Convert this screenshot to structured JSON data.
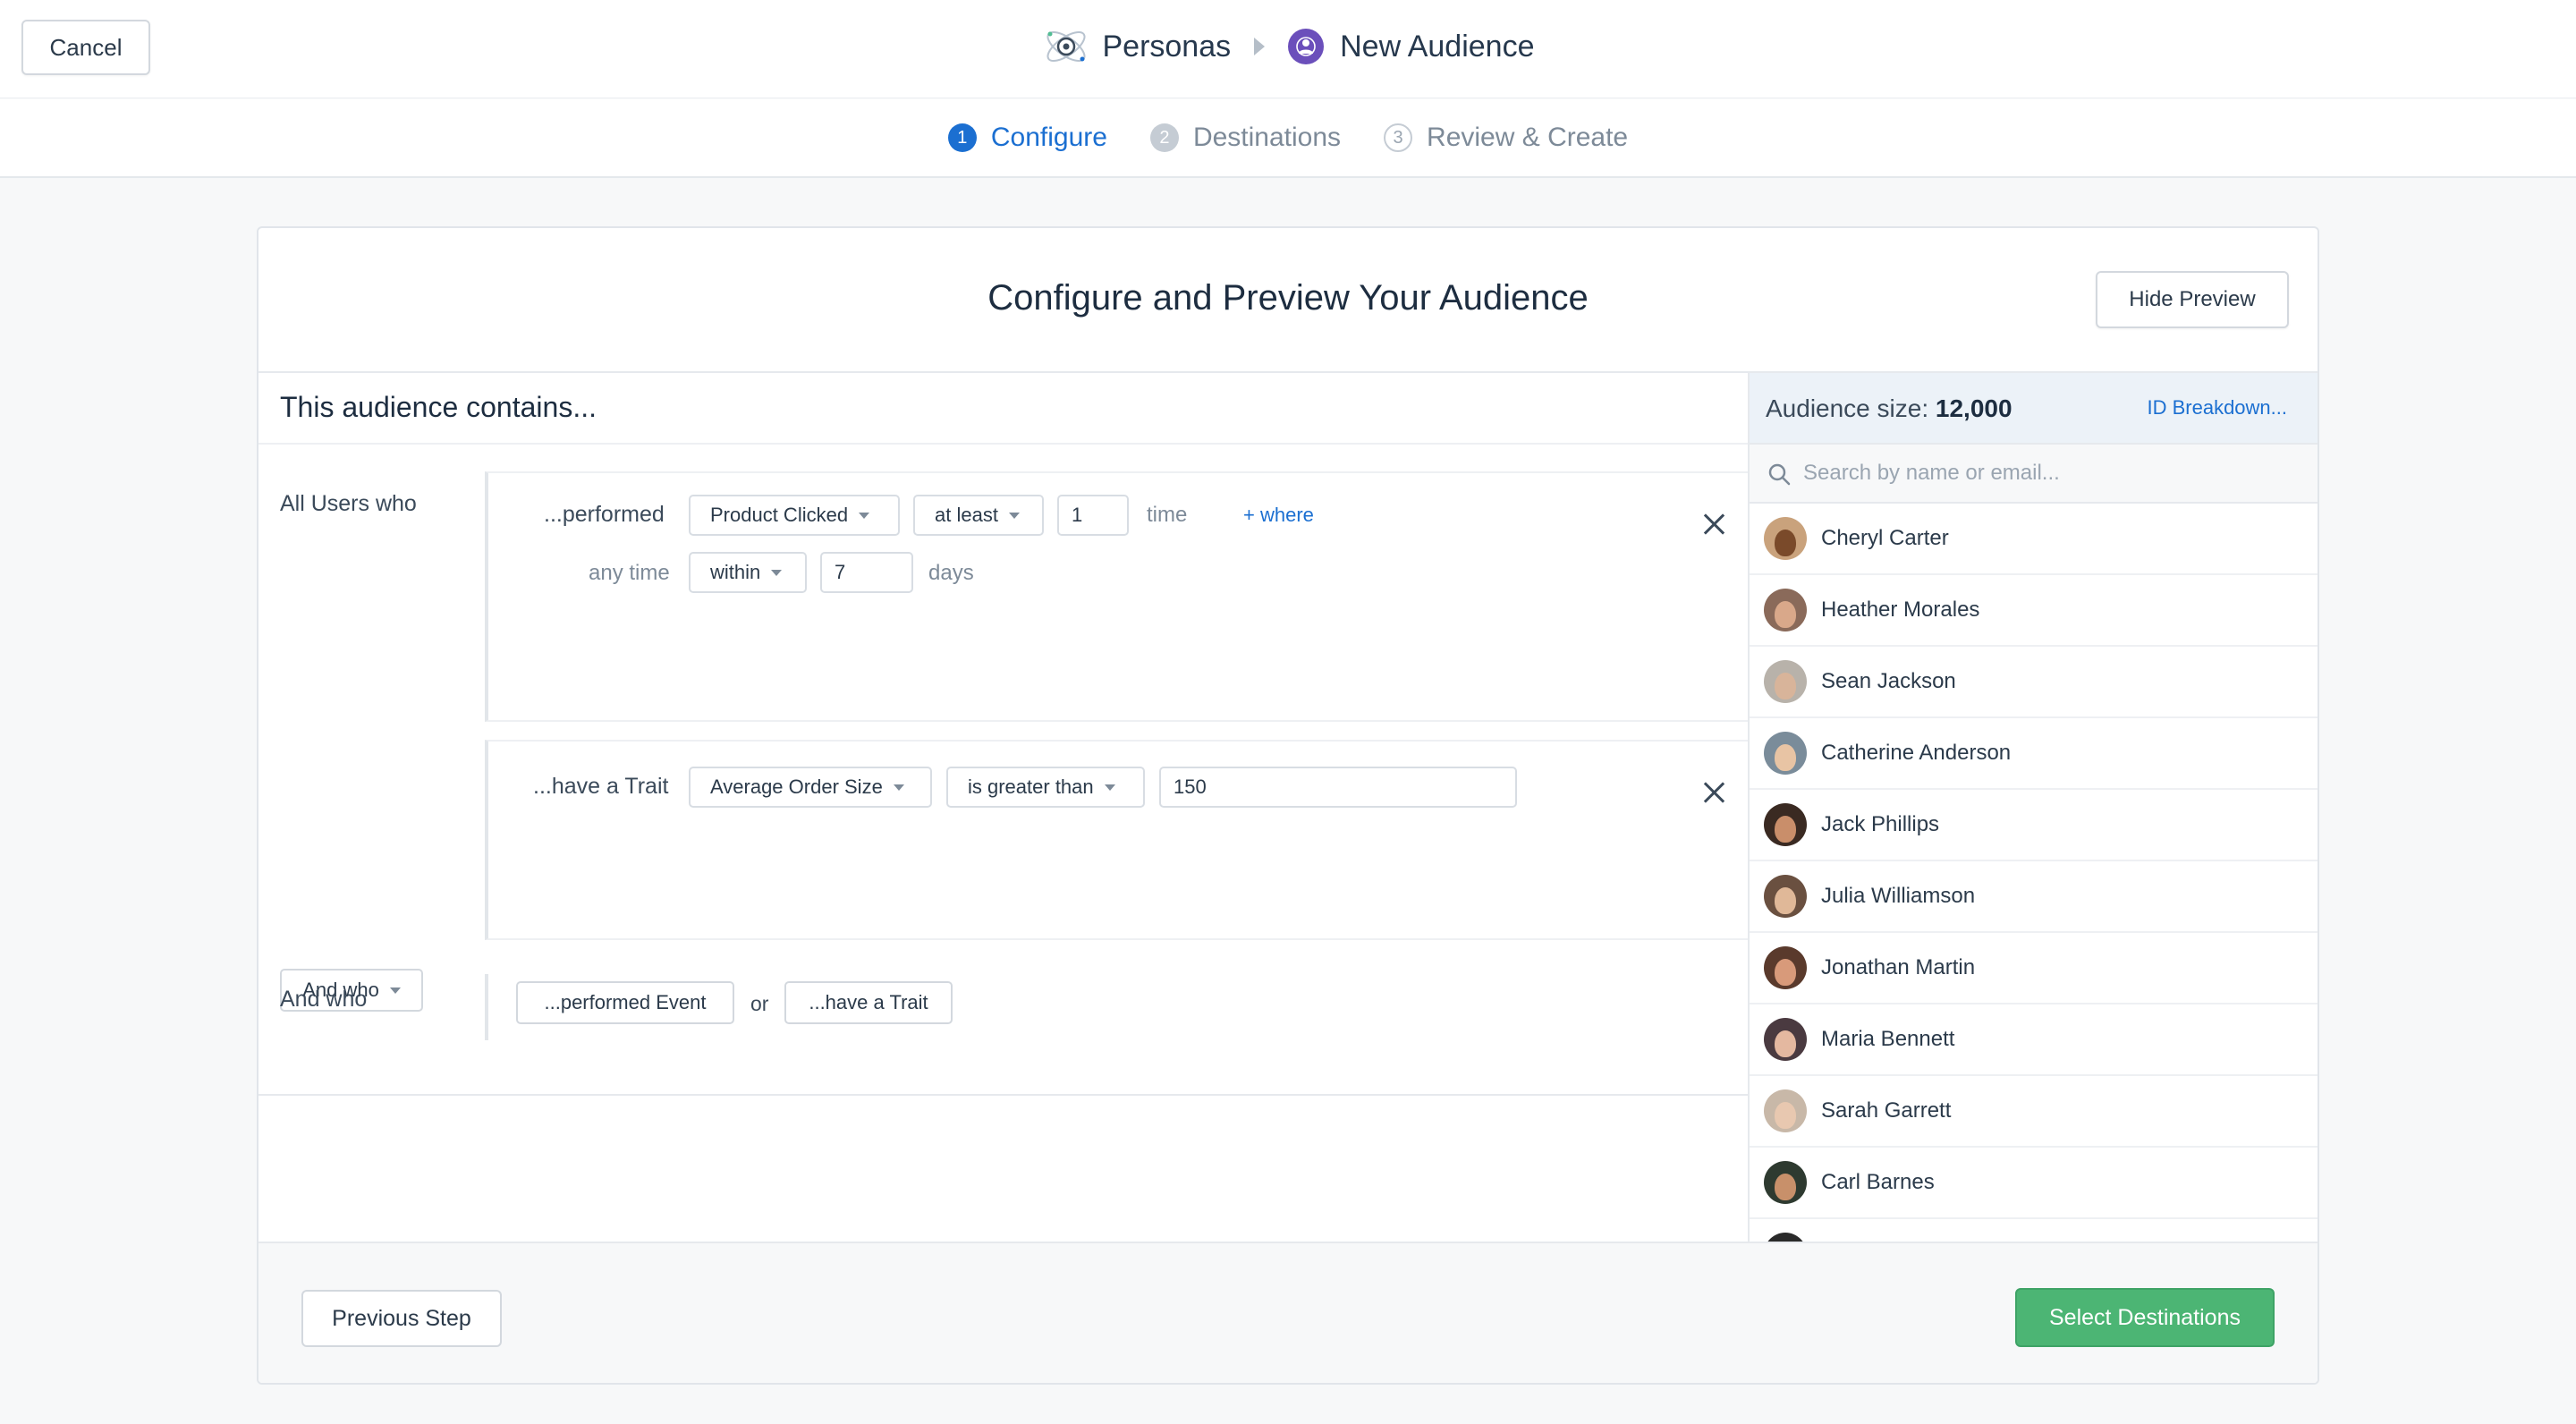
{
  "header": {
    "cancel_label": "Cancel",
    "app_name": "Personas",
    "page_name": "New Audience"
  },
  "steps": [
    {
      "num": "1",
      "label": "Configure",
      "state": "active"
    },
    {
      "num": "2",
      "label": "Destinations",
      "state": "muted"
    },
    {
      "num": "3",
      "label": "Review & Create",
      "state": "outline"
    }
  ],
  "card": {
    "title": "Configure and Preview Your Audience",
    "hide_preview_label": "Hide Preview"
  },
  "builder": {
    "contains_title": "This audience contains...",
    "row1": {
      "label": "All Users who",
      "performed_text": "...performed",
      "event_select": "Product Clicked",
      "frequency_select": "at least",
      "count_value": "1",
      "count_unit": "time",
      "where_link": "+ where",
      "time_text": "any time",
      "window_select": "within",
      "days_value": "7",
      "days_unit": "days"
    },
    "row2": {
      "label": "And who",
      "trait_text": "...have a Trait",
      "trait_select": "Average Order Size",
      "operator_select": "is greater than",
      "trait_value": "150"
    },
    "row3": {
      "label": "And who",
      "performed_event_btn": "...performed Event",
      "or_text": "or",
      "have_trait_btn": "...have a Trait"
    }
  },
  "preview": {
    "size_label": "Audience size:",
    "size_value": "12,000",
    "id_breakdown_label": "ID Breakdown...",
    "search_placeholder": "Search by name or email...",
    "people": [
      {
        "name": "Cheryl Carter",
        "bg": "#c9a27c",
        "face": "#7a4a2a"
      },
      {
        "name": "Heather Morales",
        "bg": "#8a6a5a",
        "face": "#d9a88a"
      },
      {
        "name": "Sean Jackson",
        "bg": "#b8b2aa",
        "face": "#d8b49a"
      },
      {
        "name": "Catherine Anderson",
        "bg": "#7a8c9a",
        "face": "#e8c4a4"
      },
      {
        "name": "Jack Phillips",
        "bg": "#3a2a22",
        "face": "#c98e6a"
      },
      {
        "name": "Julia Williamson",
        "bg": "#6a5040",
        "face": "#e0b898"
      },
      {
        "name": "Jonathan Martin",
        "bg": "#5a3a2c",
        "face": "#d89a7a"
      },
      {
        "name": "Maria Bennett",
        "bg": "#4a3a40",
        "face": "#e4b8a0"
      },
      {
        "name": "Sarah Garrett",
        "bg": "#c8b8a8",
        "face": "#e8c8b0"
      },
      {
        "name": "Carl Barnes",
        "bg": "#2e3a30",
        "face": "#c8906a"
      }
    ]
  },
  "footer": {
    "previous_label": "Previous Step",
    "next_label": "Select Destinations"
  },
  "colors": {
    "accent": "#1b6fd1",
    "success": "#4cb574",
    "brand_purple": "#6b4fbb"
  }
}
